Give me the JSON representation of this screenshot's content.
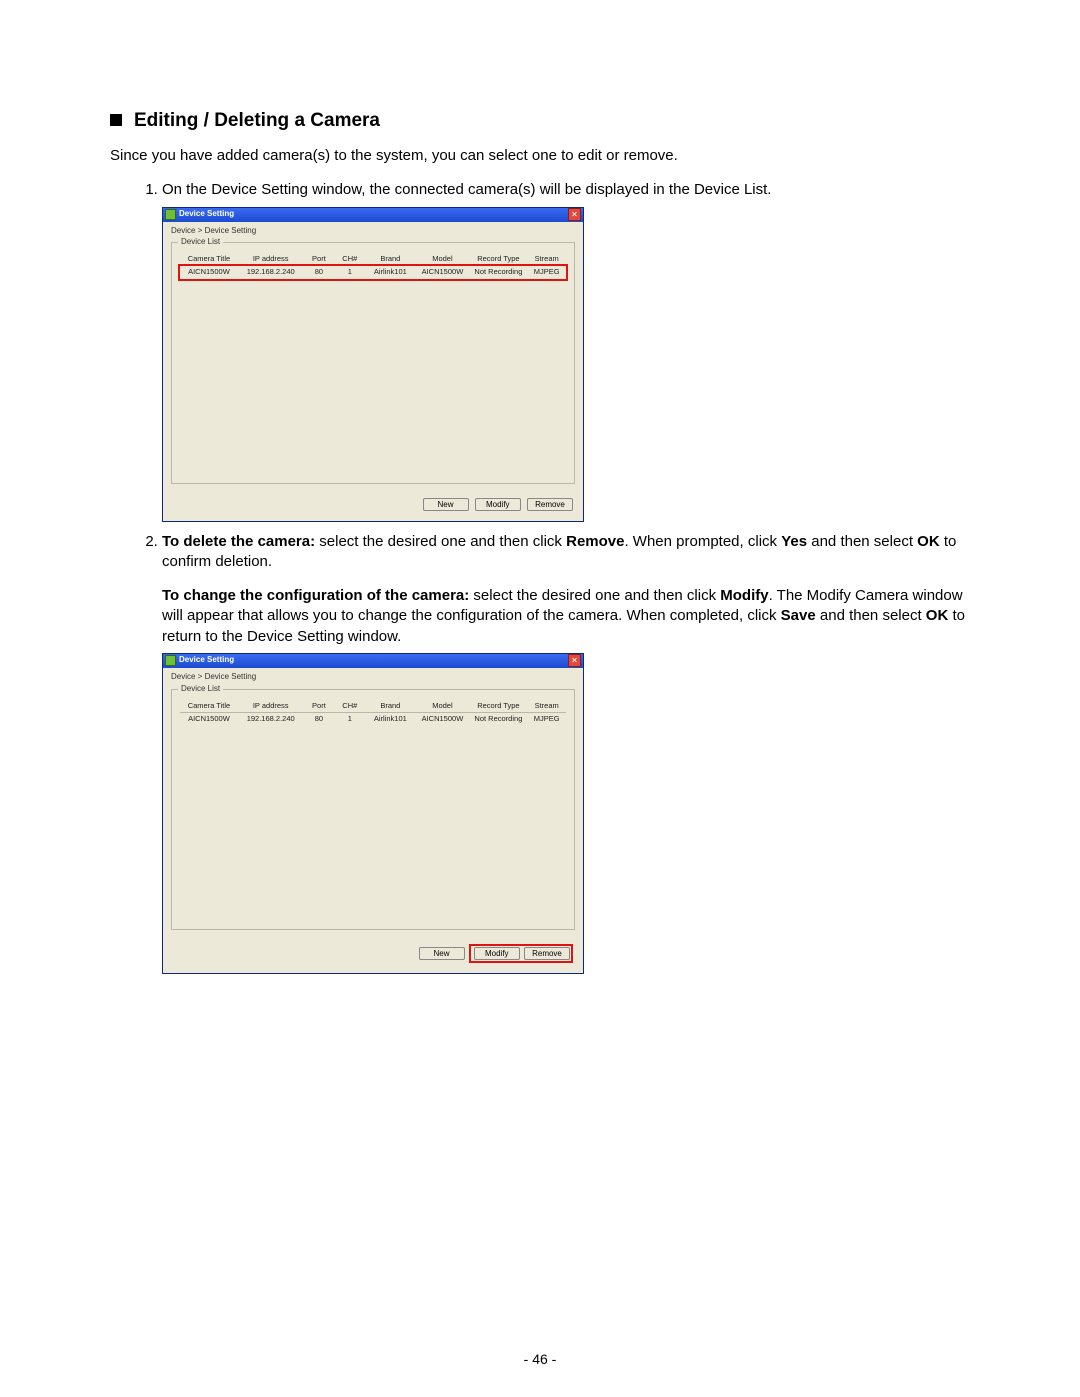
{
  "heading": "Editing / Deleting a Camera",
  "intro": "Since you have added camera(s) to the system, you can select one to edit or remove.",
  "step1": "On the Device Setting window, the connected camera(s) will be displayed in the Device List.",
  "step2a_bold": "To delete the camera:",
  "step2a_1": " select the desired one and then click ",
  "step2a_remove": "Remove",
  "step2a_2": ". When prompted, click ",
  "step2a_yes": "Yes",
  "step2a_3": " and then select ",
  "step2a_ok": "OK",
  "step2a_4": " to confirm deletion.",
  "step2b_bold": "To change the configuration of the camera:",
  "step2b_1": " select the desired one and then click ",
  "step2b_modify": "Modify",
  "step2b_2": ". The Modify Camera window will appear that allows you to change the configuration of the camera. When completed, click ",
  "step2b_save": "Save",
  "step2b_3": " and then select ",
  "step2b_ok": "OK",
  "step2b_4": " to return to the Device Setting window.",
  "page_number": "- 46 -",
  "dialog": {
    "title": "Device Setting",
    "breadcrumb": "Device > Device Setting",
    "group_label": "Device List",
    "headers": {
      "camera_title": "Camera Title",
      "ip": "IP address",
      "port": "Port",
      "ch": "CH#",
      "brand": "Brand",
      "model": "Model",
      "record_type": "Record Type",
      "stream": "Stream"
    },
    "row": {
      "camera_title": "AICN1500W",
      "ip": "192.168.2.240",
      "port": "80",
      "ch": "1",
      "brand": "Airlink101",
      "model": "AICN1500W",
      "record_type": "Not Recording",
      "stream": "MJPEG"
    },
    "buttons": {
      "new": "New",
      "modify": "Modify",
      "remove": "Remove"
    },
    "close_glyph": "✕"
  }
}
